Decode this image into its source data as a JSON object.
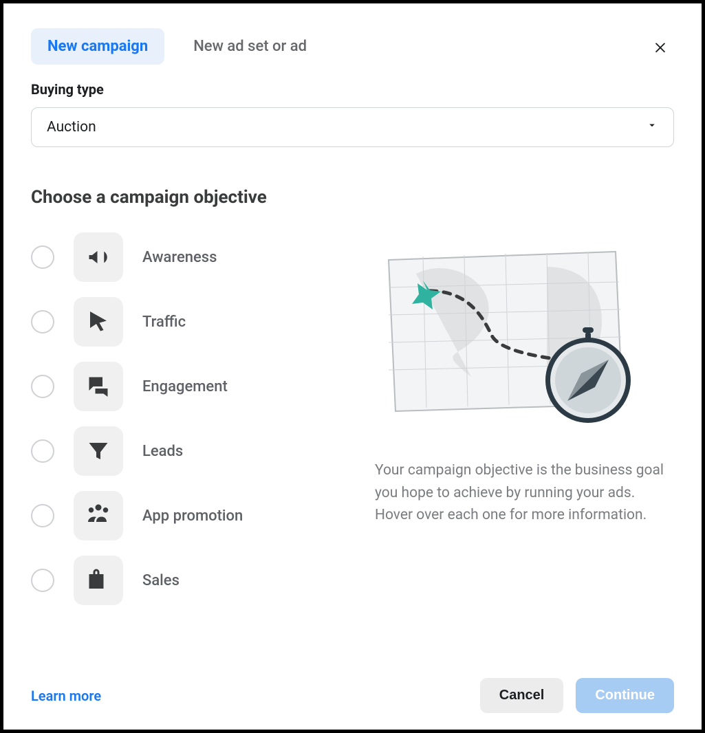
{
  "tabs": {
    "new_campaign": "New campaign",
    "new_ad_set": "New ad set or ad"
  },
  "buying_type": {
    "label": "Buying type",
    "selected": "Auction"
  },
  "objective_heading": "Choose a campaign objective",
  "objectives": [
    {
      "key": "awareness",
      "label": "Awareness",
      "icon": "megaphone-icon"
    },
    {
      "key": "traffic",
      "label": "Traffic",
      "icon": "cursor-icon"
    },
    {
      "key": "engagement",
      "label": "Engagement",
      "icon": "chat-icon"
    },
    {
      "key": "leads",
      "label": "Leads",
      "icon": "funnel-icon"
    },
    {
      "key": "app_promotion",
      "label": "App promotion",
      "icon": "people-icon"
    },
    {
      "key": "sales",
      "label": "Sales",
      "icon": "bag-icon"
    }
  ],
  "info_text": "Your campaign objective is the business goal you hope to achieve by running your ads. Hover over each one for more information.",
  "footer": {
    "learn_more": "Learn more",
    "cancel": "Cancel",
    "continue": "Continue"
  }
}
